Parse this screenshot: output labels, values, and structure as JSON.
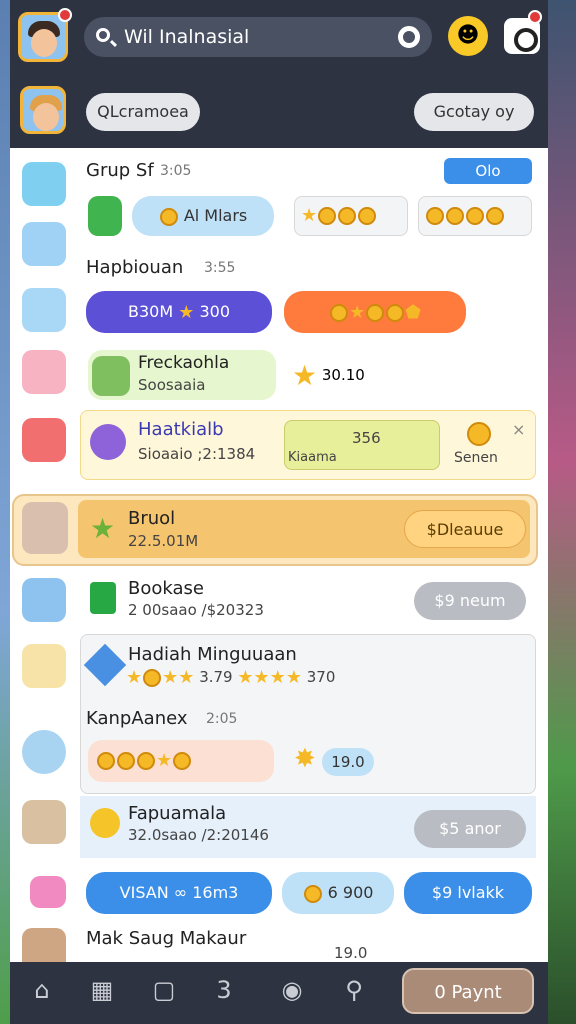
{
  "header": {
    "search_text": "Wil Inalnasial",
    "filter_label": "QLcramoea",
    "group_label": "Gcotay oy"
  },
  "rows": {
    "grup": {
      "title": "Grup Sf",
      "time": "3:05",
      "badge": "Olo",
      "pill": "Al Mlars"
    },
    "hapbl": {
      "title": "Hapbiouan",
      "time": "3:55",
      "pill": "B30M",
      "value": "300"
    },
    "freck": {
      "title": "Freckaohla",
      "sub": "Soosaaia",
      "value": "30.10"
    },
    "haatk": {
      "title": "Haatkialb",
      "sub": "Sioaaio ;2:1384",
      "box_value": "356",
      "box_label": "Kiaama",
      "coin_label": "Senen"
    },
    "bruol": {
      "title": "Bruol",
      "sub": "22.5.01M",
      "button": "Dleauue",
      "button_sym": "$"
    },
    "bookase": {
      "title": "Bookase",
      "sub": "2 00saao /$20323",
      "button": "9 neum",
      "button_sym": "$"
    },
    "hadiah": {
      "title": "Hadiah Minguuaan",
      "value1": "3.79",
      "value2": "370"
    },
    "kanpa": {
      "title": "KanpAanex",
      "time": "2:05",
      "value": "19.0"
    },
    "fapua": {
      "title": "Fapuamala",
      "sub": "32.0saao /2:20146",
      "button": "5 anor",
      "button_sym": "$"
    },
    "visan": {
      "pill1": "VISAN",
      "pill1_val": "16m3",
      "pill2": "6 900",
      "pill3": "9 lvlakk",
      "pill3_sym": "$"
    },
    "mak": {
      "title": "Mak Saug Makaur",
      "value": "19.0"
    }
  },
  "nav": {
    "pay_label": "0 Paynt",
    "bell_count": "3"
  },
  "colors": {
    "bg_dark": "#2d3341",
    "accent_blue": "#3b8fe8",
    "accent_orange": "#ff7a3d",
    "accent_purple": "#5c50d6"
  }
}
